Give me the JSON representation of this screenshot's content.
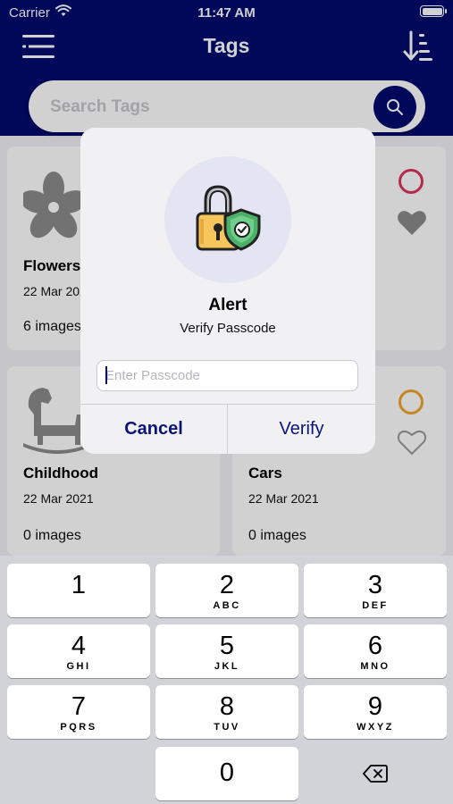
{
  "status_bar": {
    "carrier": "Carrier",
    "time": "11:47 AM"
  },
  "header": {
    "title": "Tags"
  },
  "search": {
    "placeholder": "Search Tags"
  },
  "cards": [
    {
      "title": "Flowers",
      "date": "22 Mar 2021",
      "count": "6 images",
      "ring_color": "#d9365e"
    },
    {
      "title": "Childhood",
      "date": "22 Mar 2021",
      "count": "0 images"
    },
    {
      "title": "Cars",
      "date": "22 Mar 2021",
      "count": "0 images",
      "ring_color": "#f0a52a"
    }
  ],
  "alert": {
    "title": "Alert",
    "message": "Verify Passcode",
    "input_placeholder": "Enter Passcode",
    "cancel_label": "Cancel",
    "verify_label": "Verify"
  },
  "keypad": {
    "keys": [
      {
        "digit": "1",
        "letters": ""
      },
      {
        "digit": "2",
        "letters": "ABC"
      },
      {
        "digit": "3",
        "letters": "DEF"
      },
      {
        "digit": "4",
        "letters": "GHI"
      },
      {
        "digit": "5",
        "letters": "JKL"
      },
      {
        "digit": "6",
        "letters": "MNO"
      },
      {
        "digit": "7",
        "letters": "PQRS"
      },
      {
        "digit": "8",
        "letters": "TUV"
      },
      {
        "digit": "9",
        "letters": "WXYZ"
      },
      {
        "digit": "0",
        "letters": ""
      }
    ]
  },
  "colors": {
    "brand": "#000a6e",
    "button_text": "#0a1478"
  },
  "icons": [
    "wifi-icon",
    "battery-icon",
    "menu-icon",
    "sort-icon",
    "search-icon",
    "flower-icon",
    "heart-icon",
    "rocking-horse-icon",
    "lock-shield-icon",
    "delete-backspace-icon"
  ]
}
